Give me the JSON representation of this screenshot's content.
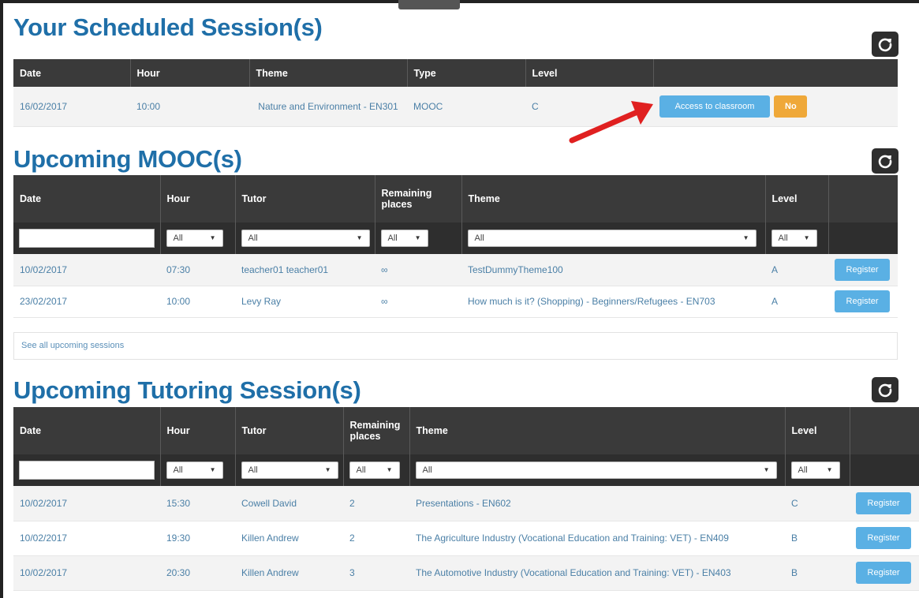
{
  "scheduled": {
    "title": "Your Scheduled Session(s)",
    "columns": [
      "Date",
      "Hour",
      "Theme",
      "Type",
      "Level",
      ""
    ],
    "row": {
      "date": "16/02/2017",
      "hour": "10:00",
      "theme": "Nature and Environment - EN301",
      "type": "MOOC",
      "level": "C",
      "access_button": "Access to classroom",
      "no_button": "No"
    }
  },
  "mooc": {
    "title": "Upcoming MOOC(s)",
    "columns": [
      "Date",
      "Hour",
      "Tutor",
      "Remaining places",
      "Theme",
      "Level",
      ""
    ],
    "filters": {
      "hour": "All",
      "tutor": "All",
      "places": "All",
      "theme": "All",
      "level": "All"
    },
    "rows": [
      {
        "date": "10/02/2017",
        "hour": "07:30",
        "tutor": "teacher01 teacher01",
        "places": "∞",
        "theme": "TestDummyTheme100",
        "level": "A",
        "action": "Register"
      },
      {
        "date": "23/02/2017",
        "hour": "10:00",
        "tutor": "Levy Ray",
        "places": "∞",
        "theme": "How much is it? (Shopping) - Beginners/Refugees - EN703",
        "level": "A",
        "action": "Register"
      }
    ],
    "see_all": "See all upcoming sessions"
  },
  "tutoring": {
    "title": "Upcoming Tutoring Session(s)",
    "columns": [
      "Date",
      "Hour",
      "Tutor",
      "Remaining places",
      "Theme",
      "Level",
      ""
    ],
    "filters": {
      "hour": "All",
      "tutor": "All",
      "places": "All",
      "theme": "All",
      "level": "All"
    },
    "rows": [
      {
        "date": "10/02/2017",
        "hour": "15:30",
        "tutor": "Cowell David",
        "places": "2",
        "theme": "Presentations - EN602",
        "level": "C",
        "action": "Register"
      },
      {
        "date": "10/02/2017",
        "hour": "19:30",
        "tutor": "Killen Andrew",
        "places": "2",
        "theme": "The Agriculture Industry (Vocational Education and Training: VET) - EN409",
        "level": "B",
        "action": "Register"
      },
      {
        "date": "10/02/2017",
        "hour": "20:30",
        "tutor": "Killen Andrew",
        "places": "3",
        "theme": "The Automotive Industry (Vocational Education and Training: VET) - EN403",
        "level": "B",
        "action": "Register"
      }
    ]
  },
  "icons": {
    "refresh": "refresh-icon",
    "caret": "caret-down-icon",
    "annotation": "red-arrow-icon"
  },
  "colors": {
    "title": "#1f6fa8",
    "header_bg": "#3a3a3a",
    "button_blue": "#5ab0e4",
    "button_orange": "#efa839",
    "arrow": "#e02020"
  }
}
